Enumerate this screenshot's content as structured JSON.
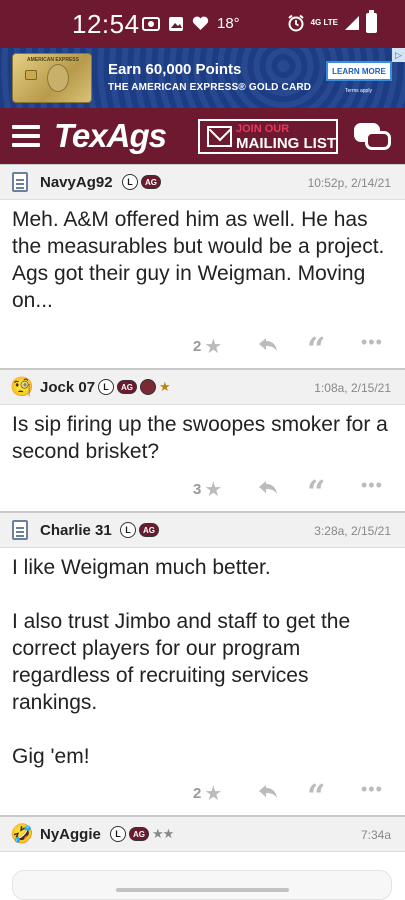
{
  "status_bar": {
    "time": "12:54",
    "temperature": "18°",
    "network": "4G LTE"
  },
  "ad": {
    "card_text": "AMERICAN EXPRESS",
    "title": "Earn 60,000 Points",
    "subtitle": "THE AMERICAN EXPRESS® GOLD CARD",
    "cta": "LEARN MORE",
    "terms": "Terms apply",
    "info": "▷"
  },
  "header": {
    "logo": "TexAgs",
    "join_top": "JOIN OUR",
    "join_bottom": "MAILING LIST"
  },
  "posts": [
    {
      "username": "NavyAg92",
      "badges": [
        "L",
        "AG"
      ],
      "timestamp": "10:52p, 2/14/21",
      "paragraphs": [
        "Meh. A&M offered him as well. He has the measurables but would be a project. Ags got their guy in Weigman. Moving on..."
      ],
      "stars": "2"
    },
    {
      "username": "Jock 07",
      "badges": [
        "L",
        "AG"
      ],
      "rank_stars": "★",
      "timestamp": "1:08a, 2/15/21",
      "paragraphs": [
        "Is sip firing up the swoopes smoker for a second brisket?"
      ],
      "stars": "3"
    },
    {
      "username": "Charlie 31",
      "badges": [
        "L",
        "AG"
      ],
      "timestamp": "3:28a, 2/15/21",
      "paragraphs": [
        "I like Weigman much better.",
        "I also trust Jimbo and staff to get the correct players for our program regardless of recruiting services rankings.",
        "Gig 'em!"
      ],
      "stars": "2"
    },
    {
      "username": "NyAggie",
      "badges": [
        "L",
        "AG"
      ],
      "rank_stars": "★★",
      "timestamp": "7:34a"
    }
  ]
}
